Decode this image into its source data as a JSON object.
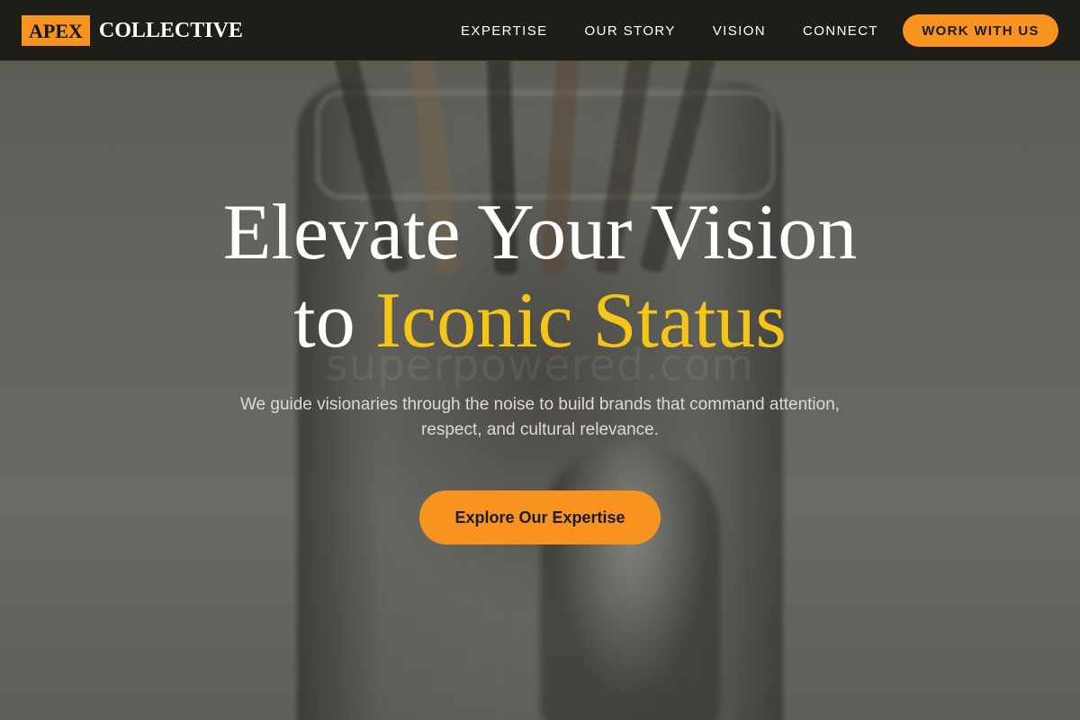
{
  "header": {
    "logo": {
      "mark": "APEX",
      "word": "COLLECTIVE"
    },
    "nav": [
      {
        "label": "EXPERTISE"
      },
      {
        "label": "OUR STORY"
      },
      {
        "label": "VISION"
      },
      {
        "label": "CONNECT"
      }
    ],
    "cta_label": "WORK WITH US"
  },
  "hero": {
    "headline_line1": "Elevate Your Vision",
    "headline_to": "to",
    "headline_accent": "Iconic Status",
    "subtitle": "We guide visionaries through the noise to build brands that command attention, respect, and cultural relevance.",
    "cta_label": "Explore Our Expertise",
    "watermark": "superpowered.com"
  },
  "colors": {
    "accent_orange": "#f7931e",
    "accent_yellow": "#f5c518",
    "navbar_bg": "#1b1a14"
  }
}
